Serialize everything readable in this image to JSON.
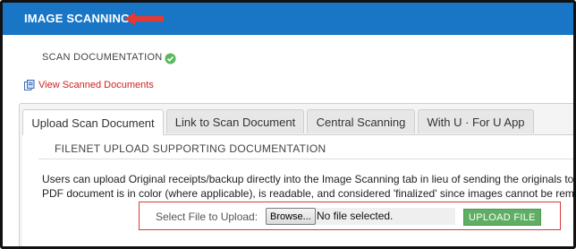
{
  "header": {
    "title": "IMAGE SCANNING",
    "bar_color": "#1976c6",
    "annotation": "red-arrow-icon"
  },
  "section": {
    "title": "SCAN DOCUMENTATION",
    "status_icon": "check-circle-icon",
    "status_color": "#5cb85c"
  },
  "view_link": {
    "icon": "documents-icon",
    "label": "View Scanned Documents",
    "color": "#d42020"
  },
  "tabs": [
    {
      "label": "Upload Scan Document",
      "active": true
    },
    {
      "label": "Link to Scan Document",
      "active": false
    },
    {
      "label": "Central Scanning",
      "active": false
    },
    {
      "label": "With U · For U App",
      "active": false
    }
  ],
  "content": {
    "heading": "FILENET UPLOAD SUPPORTING DOCUMENTATION",
    "description_lines": [
      "Users can upload Original receipts/backup directly into the Image Scanning tab in lieu of sending the originals to",
      "PDF document is in color (where applicable), is readable, and considered 'finalized' since images cannot be remov"
    ]
  },
  "upload": {
    "label": "Select File to Upload:",
    "browse_label": "Browse...",
    "file_status": "No file selected.",
    "button_label": "UPLOAD FILE",
    "button_color": "#5fae63",
    "highlight_color": "#d63a3a"
  }
}
